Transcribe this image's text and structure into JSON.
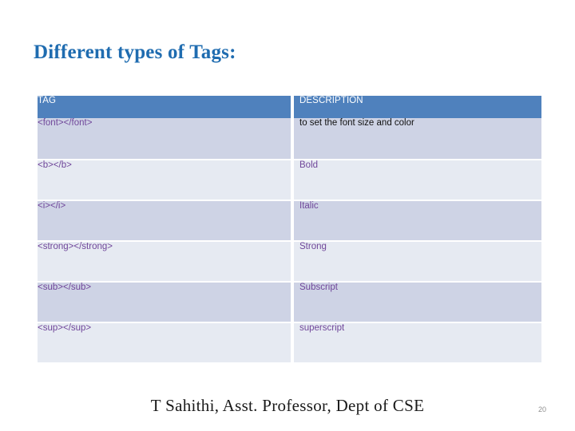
{
  "slide": {
    "title": "Different types of Tags:",
    "page_number": "20",
    "footer": "T Sahithi, Asst. Professor, Dept of CSE",
    "colors": {
      "title": "#1f6cb0",
      "header_bg": "#4f81bd",
      "header_text": "#ffffff",
      "row_dark": "#ced3e5",
      "row_light": "#e6eaf2",
      "cell_text": "#70479a",
      "cell_text_alt": "#101010",
      "page_number": "#8f8f8f"
    }
  },
  "table": {
    "headers": {
      "tag": "TAG",
      "description": "DESCRIPTION"
    },
    "rows": [
      {
        "tag": "<font></font>",
        "description": " to set the font size and color"
      },
      {
        "tag": "<b></b>",
        "description": "Bold"
      },
      {
        "tag": "<i></i>",
        "description": "Italic"
      },
      {
        "tag": "<strong></strong>",
        "description": "Strong"
      },
      {
        "tag": "<sub></sub>",
        "description": "Subscript"
      },
      {
        "tag": "<sup></sup>",
        "description": "superscript"
      }
    ]
  }
}
